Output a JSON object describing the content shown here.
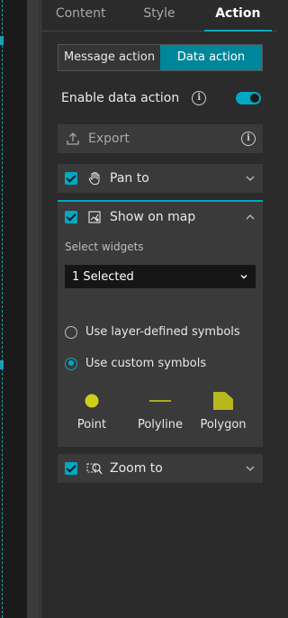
{
  "tabs": [
    {
      "label": "Content",
      "active": false
    },
    {
      "label": "Style",
      "active": false
    },
    {
      "label": "Action",
      "active": true
    }
  ],
  "segmented": {
    "message_action": "Message action",
    "data_action": "Data action",
    "selected": "Data action"
  },
  "enable_data_action": {
    "label": "Enable data action",
    "enabled": true
  },
  "actions": {
    "export": {
      "label": "Export",
      "icon": "export-icon",
      "enabled": false
    },
    "pan_to": {
      "label": "Pan to",
      "checked": true,
      "expanded": false,
      "icon": "hand-icon"
    },
    "show_on_map": {
      "label": "Show on map",
      "checked": true,
      "expanded": true,
      "icon": "show-on-map-icon",
      "select_label": "Select widgets",
      "select_value": "1 Selected",
      "radio_layer": "Use layer-defined symbols",
      "radio_custom": "Use custom symbols",
      "selected_radio": "custom",
      "symbols": {
        "point": "Point",
        "polyline": "Polyline",
        "polygon": "Polygon"
      }
    },
    "zoom_to": {
      "label": "Zoom to",
      "checked": true,
      "expanded": false,
      "icon": "zoom-to-icon"
    }
  },
  "colors": {
    "accent": "#00a9c1",
    "segment_active": "#00869a",
    "symbol_fill": "#cfcf1a"
  }
}
